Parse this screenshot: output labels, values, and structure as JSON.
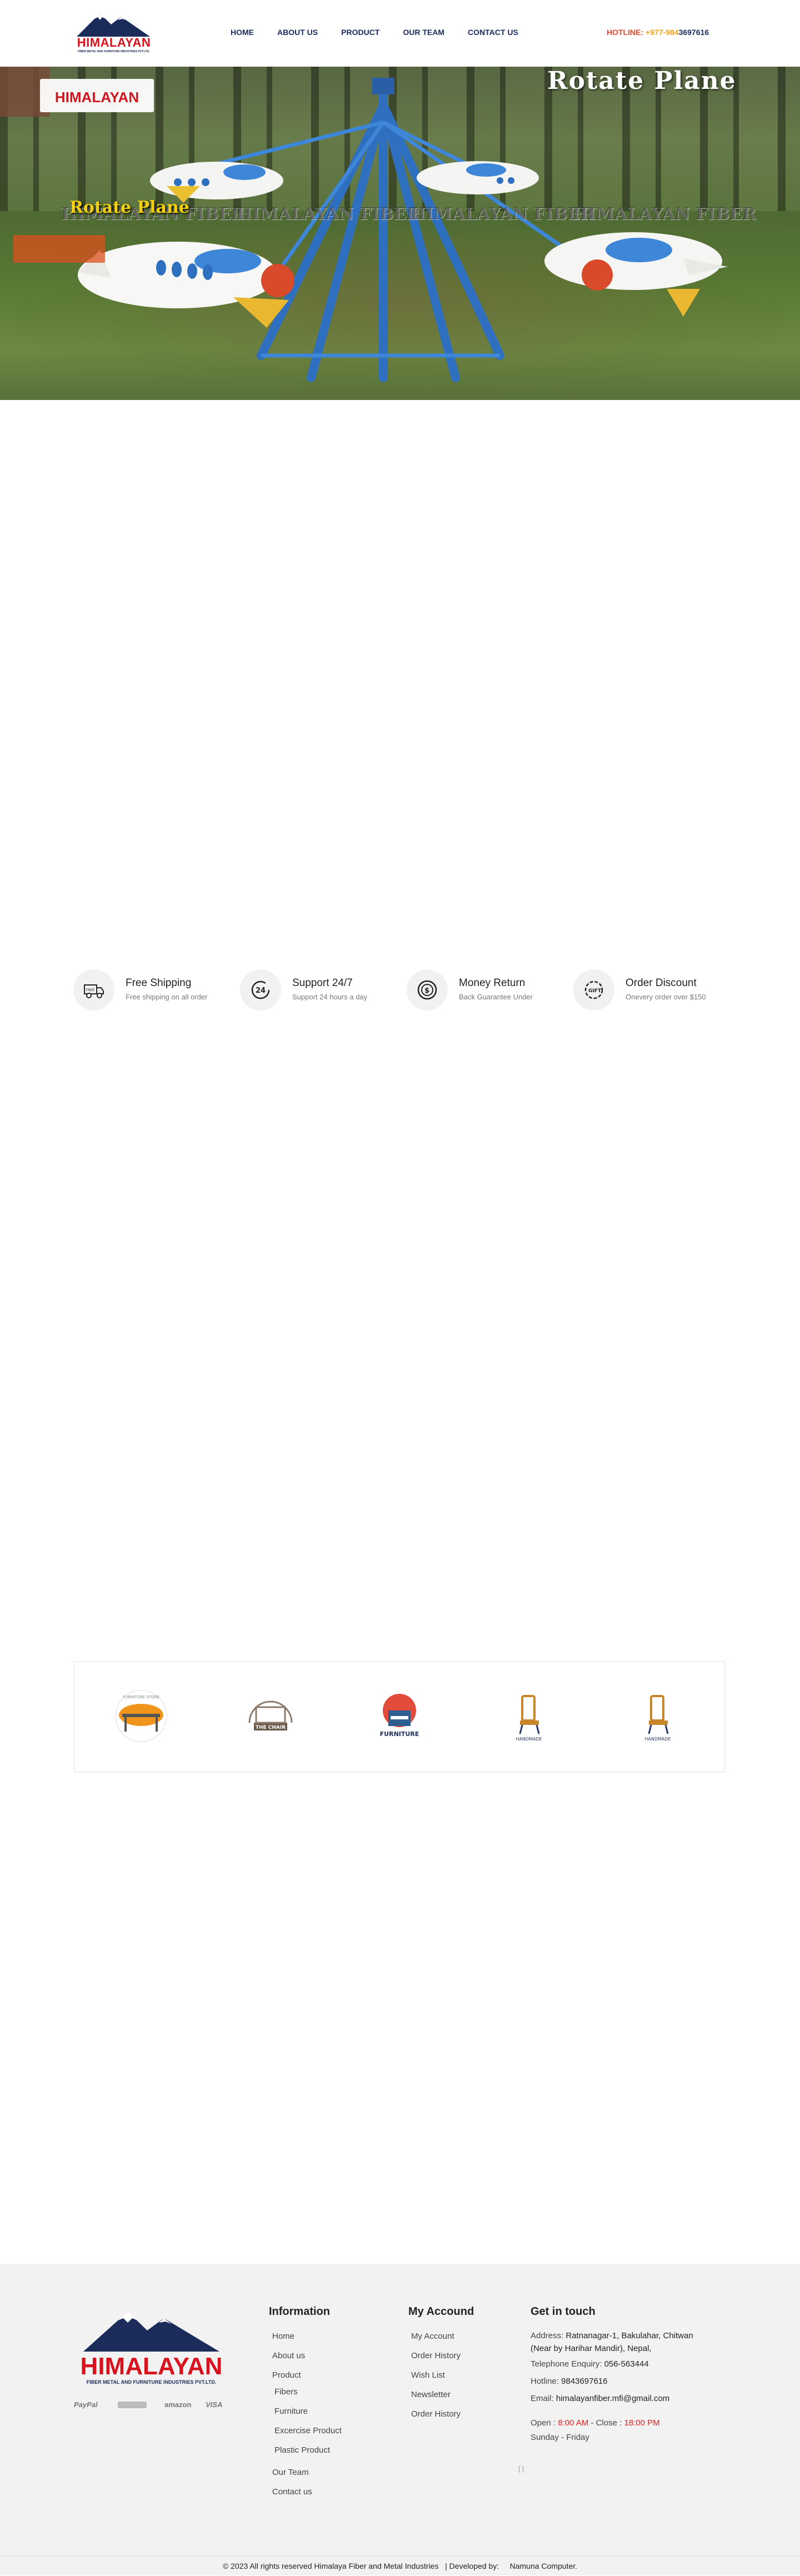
{
  "header": {
    "logo_text": "HIMALAYAN",
    "logo_sub": "FIBER METAL AND FURNITURE INDUSTRIES PVT.LTD.",
    "nav": [
      "HOME",
      "ABOUT US",
      "PRODUCT",
      "OUR TEAM",
      "CONTACT US"
    ],
    "hotline_label": "HOTLINE:",
    "hotline_prefix": "+977-984",
    "hotline_number": "3697616"
  },
  "hero": {
    "logo_text": "HIMALAYAN",
    "title": "Rotate Plane",
    "badge": "Rotate Plane",
    "watermark": "HIMALAYAN FIBER"
  },
  "features": [
    {
      "icon": "truck-icon",
      "title": "Free Shipping",
      "subtitle": "Free shipping on all order"
    },
    {
      "icon": "clock-24-icon",
      "title": "Support 24/7",
      "subtitle": "Support 24 hours a day"
    },
    {
      "icon": "money-return-icon",
      "title": "Money Return",
      "subtitle": "Back Guarantee Under"
    },
    {
      "icon": "gift-discount-icon",
      "title": "Order Discount",
      "subtitle": "Onevery order over $150"
    }
  ],
  "brands": [
    {
      "name": "furniture-store-logo",
      "label": "FURNITURE STORE"
    },
    {
      "name": "the-chair-logo",
      "label": "THE CHAIR"
    },
    {
      "name": "furniture-logo",
      "label": "FURNITURE"
    },
    {
      "name": "handmade-chair-logo-1",
      "label": "HANDMADE"
    },
    {
      "name": "handmade-chair-logo-2",
      "label": "HANDMADE"
    }
  ],
  "footer": {
    "logo_text": "HIMALAYAN",
    "logo_sub": "FIBER METAL AND FURNITURE INDUSTRIES PVT.LTD.",
    "payments": [
      "PayPal",
      "",
      "amazon",
      "VISA"
    ],
    "information_title": "Information",
    "information_links": [
      "Home",
      "About us",
      "Product"
    ],
    "product_links": [
      "Fibers",
      "Furniture",
      "Excercise Product",
      "Plastic Product"
    ],
    "information_links_2": [
      "Our Team",
      "Contact us"
    ],
    "account_title": "My Accound",
    "account_links": [
      "My Account",
      "Order History",
      "Wish List",
      "Newsletter",
      "Order History"
    ],
    "contact_title": "Get in touch",
    "address_label": "Address: ",
    "address_line1": "Ratnanagar-1, Bakulahar, Chitwan",
    "address_line2": "(Near by Harihar Mandir), Nepal,",
    "telephone_label": "Telephone Enquiry: ",
    "telephone": "056-563444",
    "hotline_label": "Hotline: ",
    "hotline": "9843697616",
    "email_label": "Email: ",
    "email": "himalayanfiber.mfi@gmail.com",
    "open_label": "Open : ",
    "open_time": "8:00 AM",
    "close_label": " - Close : ",
    "close_time": "18:00 PM",
    "days": "Sunday - Friday",
    "marker": "[ ]"
  },
  "copyright": {
    "text": "© 2023 All rights reserved Himalaya Fiber and Metal Industries",
    "developed": "| Developed by:",
    "developer": "Namuna Computer."
  },
  "colors": {
    "navy": "#1b2b5a",
    "brand_red": "#d8121e",
    "hotline_orange": "#f3a21b",
    "hero_blue": "#2f6fc0"
  }
}
